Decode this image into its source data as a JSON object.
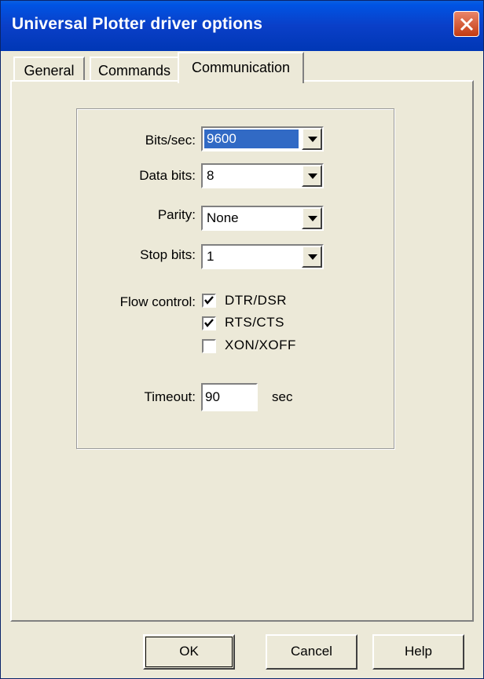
{
  "window": {
    "title": "Universal Plotter driver options"
  },
  "tabs": [
    {
      "label": "General",
      "active": false
    },
    {
      "label": "Commands",
      "active": false
    },
    {
      "label": "Communication",
      "active": true
    }
  ],
  "communication": {
    "bits_per_sec": {
      "label": "Bits/sec:",
      "value": "9600"
    },
    "data_bits": {
      "label": "Data bits:",
      "value": "8"
    },
    "parity": {
      "label": "Parity:",
      "value": "None"
    },
    "stop_bits": {
      "label": "Stop bits:",
      "value": "1"
    },
    "flow_control": {
      "label": "Flow control:",
      "options": [
        {
          "label": "DTR/DSR",
          "checked": true
        },
        {
          "label": "RTS/CTS",
          "checked": true
        },
        {
          "label": "XON/XOFF",
          "checked": false
        }
      ]
    },
    "timeout": {
      "label": "Timeout:",
      "value": "90",
      "unit": "sec"
    }
  },
  "buttons": {
    "ok": "OK",
    "cancel": "Cancel",
    "help": "Help"
  },
  "colors": {
    "titlebar": "#0a3fc8",
    "face": "#ece9d8",
    "selection": "#316ac5",
    "close": "#c43b12"
  }
}
